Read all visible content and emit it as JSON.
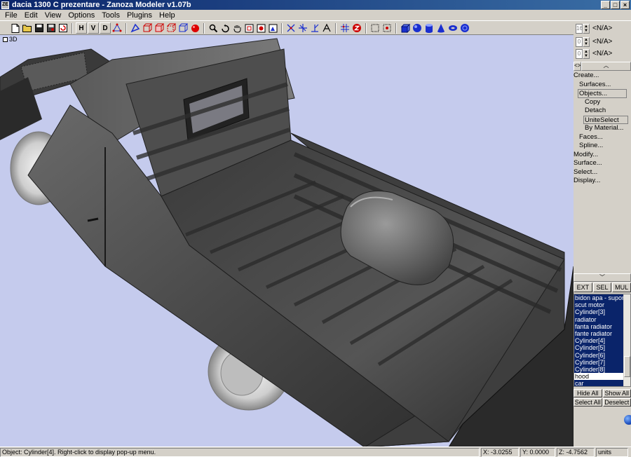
{
  "window": {
    "icon_label": "ZE",
    "title": "dacia 1300 C prezentare - Zanoza Modeler v1.07b",
    "btn_min": "_",
    "btn_max": "□",
    "btn_close": "×"
  },
  "menu": [
    "File",
    "Edit",
    "View",
    "Options",
    "Tools",
    "Plugins",
    "Help"
  ],
  "toolbar": {
    "letters": {
      "h": "H",
      "v": "V",
      "d": "D"
    }
  },
  "viewport": {
    "label": "3D"
  },
  "right_panel": {
    "spinners": [
      {
        "value": "16",
        "label": "<N/A>"
      },
      {
        "value": "0",
        "label": "<N/A>"
      },
      {
        "value": "0",
        "label": "<N/A>"
      }
    ],
    "nav_left": "<>",
    "nav_up": "︿",
    "tree": [
      {
        "label": "Create...",
        "level": 0,
        "boxed": false
      },
      {
        "label": "Surfaces...",
        "level": 1,
        "boxed": false
      },
      {
        "label": "Objects...",
        "level": 1,
        "boxed": true
      },
      {
        "label": "Copy",
        "level": 2,
        "boxed": false
      },
      {
        "label": "Detach",
        "level": 2,
        "boxed": false
      },
      {
        "label": "UniteSelect",
        "level": 2,
        "boxed": true
      },
      {
        "label": "By Material...",
        "level": 2,
        "boxed": false
      },
      {
        "label": "Faces...",
        "level": 1,
        "boxed": false
      },
      {
        "label": "Spline...",
        "level": 1,
        "boxed": false
      },
      {
        "label": "Modify...",
        "level": 0,
        "boxed": false
      },
      {
        "label": "Surface...",
        "level": 0,
        "boxed": false
      },
      {
        "label": "Select...",
        "level": 0,
        "boxed": false
      },
      {
        "label": "Display...",
        "level": 0,
        "boxed": false
      }
    ],
    "nav_down": "﹀",
    "tri_buttons": [
      "EXT",
      "SEL",
      "MUL"
    ],
    "objects": [
      {
        "name": "bidon apa - suport",
        "selected": true
      },
      {
        "name": "scut motor",
        "selected": true
      },
      {
        "name": "Cylinder[3]",
        "selected": true
      },
      {
        "name": "radiator",
        "selected": true
      },
      {
        "name": "fanta radiator",
        "selected": true
      },
      {
        "name": "fante radiator",
        "selected": true
      },
      {
        "name": "Cylinder[4]",
        "selected": true
      },
      {
        "name": "Cylinder[5]",
        "selected": true
      },
      {
        "name": "Cylinder[6]",
        "selected": true
      },
      {
        "name": "Cylinder[7]",
        "selected": true
      },
      {
        "name": "Cylinder[8]",
        "selected": true
      },
      {
        "name": "hood",
        "selected": false
      },
      {
        "name": "car",
        "selected": true
      }
    ],
    "buttons": {
      "hide_all": "Hide All",
      "show_all": "Show All",
      "select_all": "Select All",
      "deselect": "Deselect"
    }
  },
  "status": {
    "message": "Object: Cylinder[4]. Right-click to display pop-up menu.",
    "x": "X: -3.0255",
    "y": "Y: 0.0000",
    "z": "Z: -4.7562",
    "units": "units"
  }
}
